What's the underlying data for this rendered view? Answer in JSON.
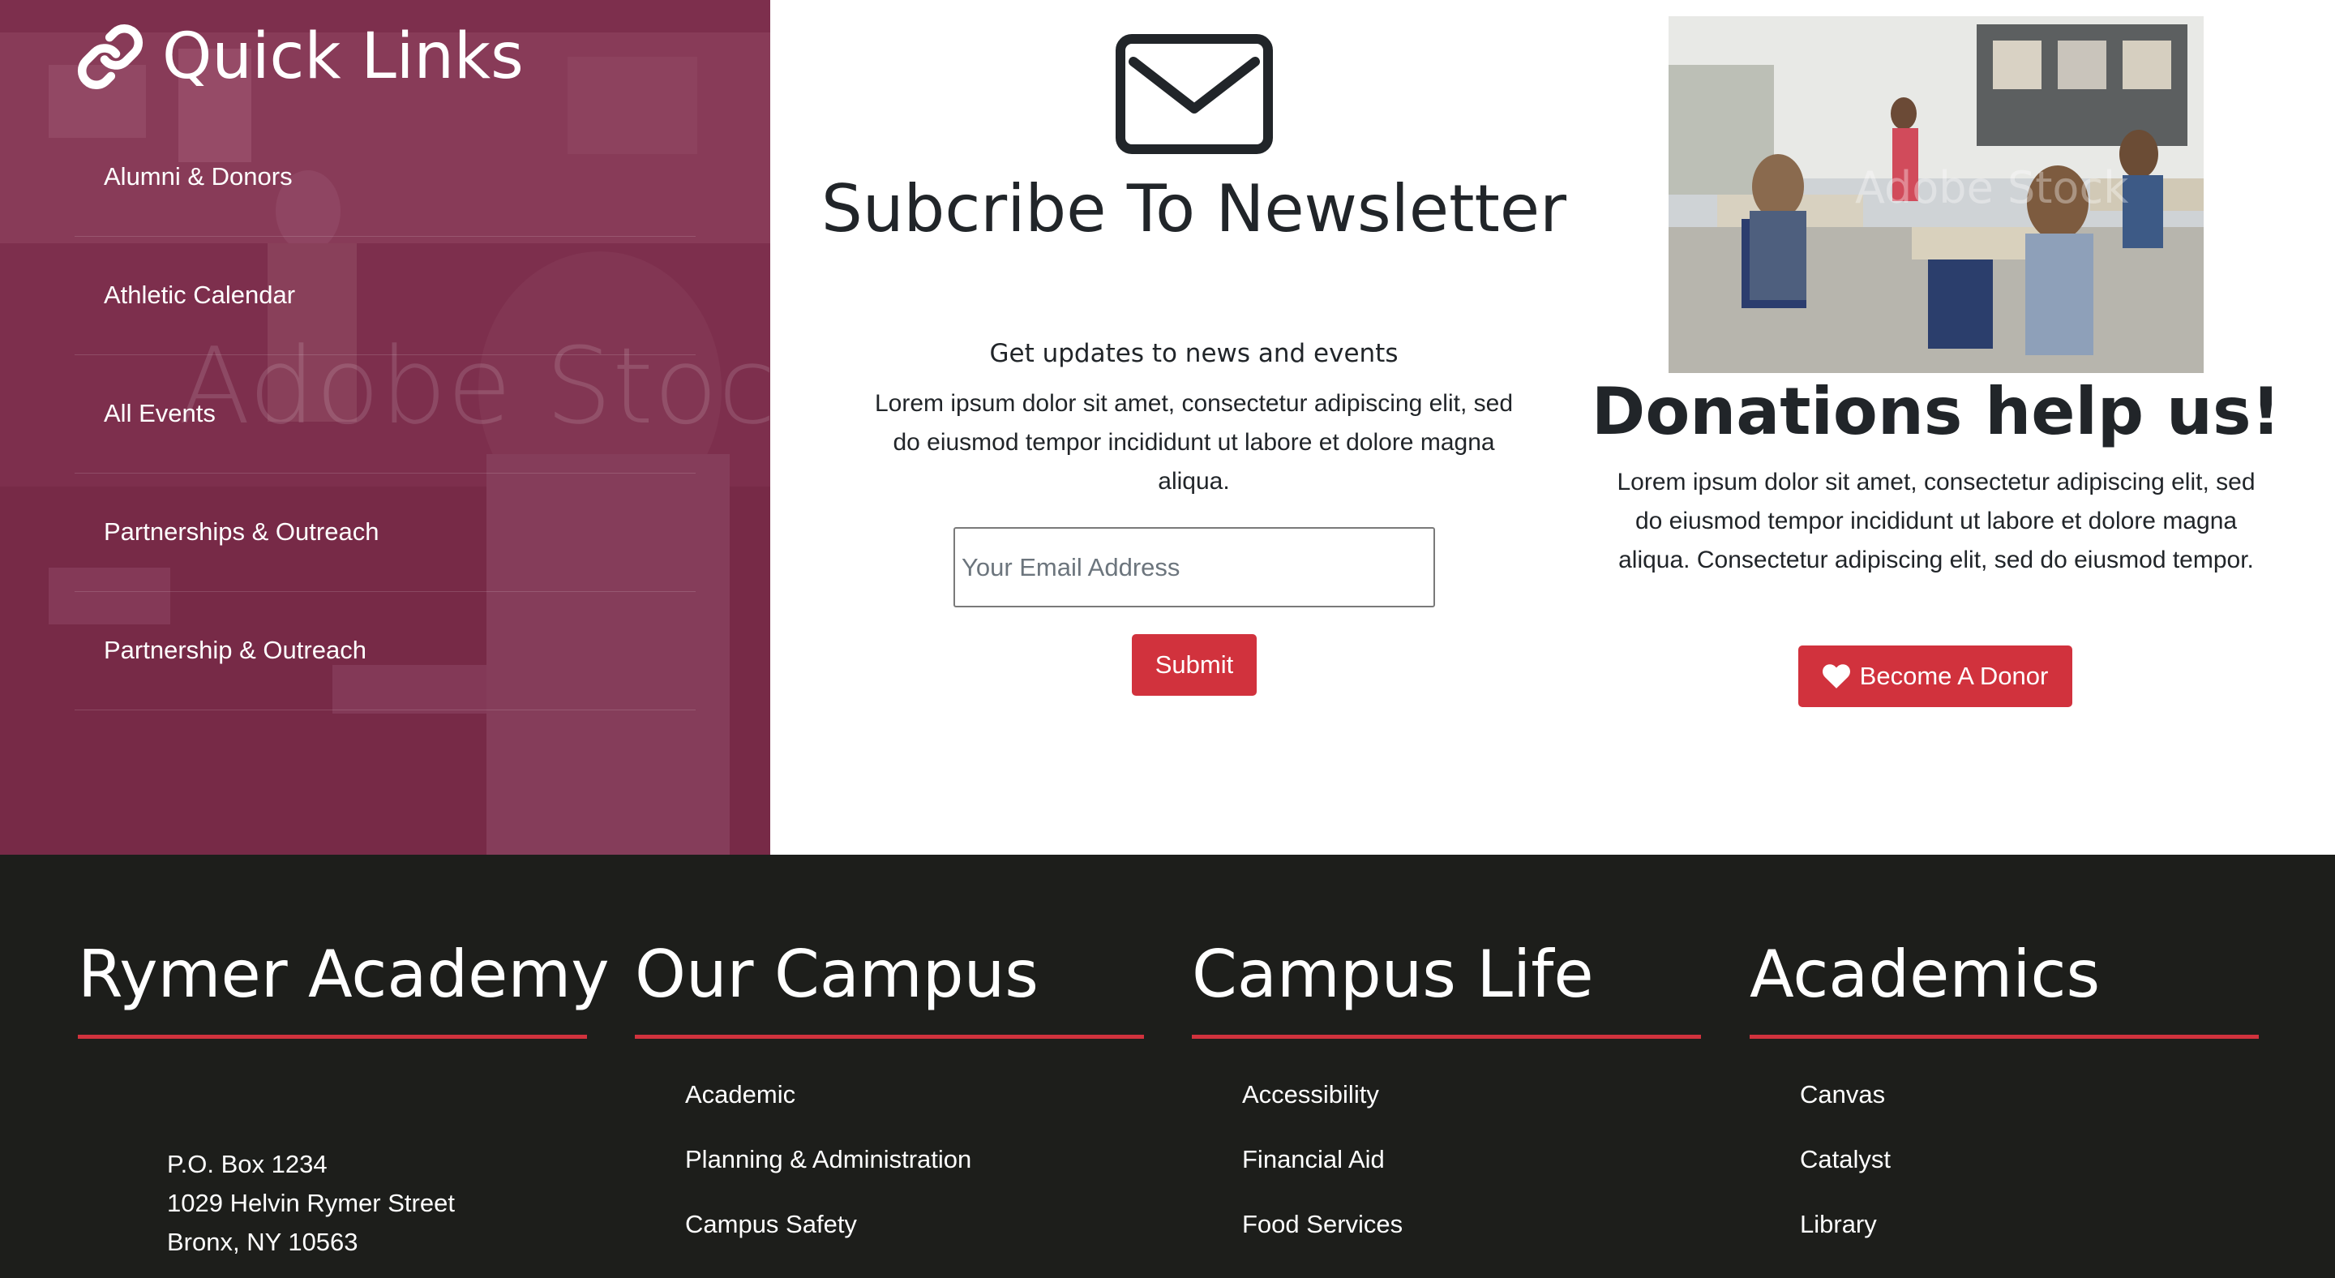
{
  "quick_links": {
    "title": "Quick Links",
    "watermark": "Adobe Stock",
    "items": [
      {
        "label": "Alumni & Donors"
      },
      {
        "label": "Athletic Calendar"
      },
      {
        "label": "All Events"
      },
      {
        "label": "Partnerships & Outreach"
      },
      {
        "label": "Partnership & Outreach"
      }
    ]
  },
  "newsletter": {
    "title": "Subcribe To Newsletter",
    "subtitle": "Get updates to news and events",
    "body": "Lorem ipsum dolor sit amet, consectetur adipiscing elit, sed do eiusmod tempor incididunt ut labore et dolore magna aliqua.",
    "email_placeholder": "Your Email Address",
    "submit_label": "Submit"
  },
  "donations": {
    "watermark": "Adobe Stock",
    "title": "Donations help us!",
    "body": "Lorem ipsum dolor sit amet, consectetur adipiscing elit, sed do eiusmod tempor incididunt ut labore et dolore magna aliqua. Consectetur adipiscing elit, sed do eiusmod tempor.",
    "button_label": "Become A Donor"
  },
  "footer": {
    "rymer": {
      "title": "Rymer Academy",
      "address": [
        "P.O. Box 1234",
        "1029 Helvin Rymer Street",
        "Bronx, NY 10563"
      ]
    },
    "campus": {
      "title": "Our Campus",
      "links": [
        "Academic",
        "Planning & Administration",
        "Campus Safety"
      ]
    },
    "campus_life": {
      "title": "Campus Life",
      "links": [
        "Accessibility",
        "Financial Aid",
        "Food Services"
      ]
    },
    "academics": {
      "title": "Academics",
      "links": [
        "Canvas",
        "Catalyst",
        "Library"
      ]
    }
  },
  "colors": {
    "accent": "#d1323d",
    "quick_links_overlay": "#802648",
    "footer_bg": "#1d1e1b"
  },
  "icons": [
    "link-icon",
    "envelope-icon",
    "heart-icon"
  ]
}
